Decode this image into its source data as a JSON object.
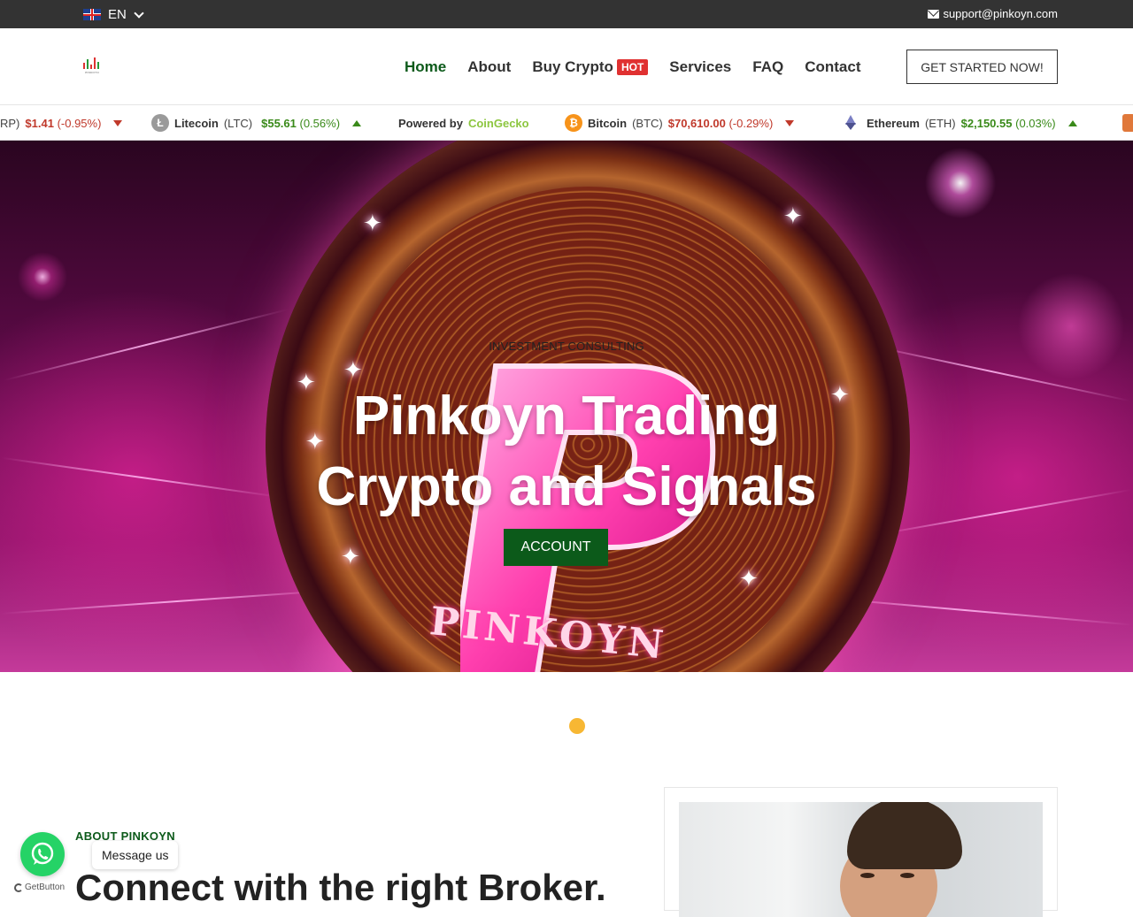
{
  "topbar": {
    "language": "EN",
    "support_email": "support@pinkoyn.com"
  },
  "header": {
    "logo_text": "PINKOYN",
    "nav": [
      {
        "label": "Home",
        "active": true
      },
      {
        "label": "About"
      },
      {
        "label": "Buy Crypto",
        "badge": "HOT"
      },
      {
        "label": "Services"
      },
      {
        "label": "FAQ"
      },
      {
        "label": "Contact"
      }
    ],
    "cta_label": "GET STARTED NOW!"
  },
  "ticker": {
    "xrp_partial": {
      "symbol_tail": "RP)",
      "price": "$1.41",
      "change": "(-0.95%)",
      "direction": "down"
    },
    "litecoin": {
      "name": "Litecoin",
      "symbol": "(LTC)",
      "price": "$55.61",
      "change": "(0.56%)",
      "direction": "up"
    },
    "powered_by": "Powered by",
    "powered_by_brand": "CoinGecko",
    "bitcoin": {
      "name": "Bitcoin",
      "symbol": "(BTC)",
      "price": "$70,610.00",
      "change": "(-0.29%)",
      "direction": "down"
    },
    "ethereum": {
      "name": "Ethereum",
      "symbol": "(ETH)",
      "price": "$2,150.55",
      "change": "(0.03%)",
      "direction": "up"
    }
  },
  "hero": {
    "subtitle": "INVESTMENT CONSULTING",
    "title_line1": "Pinkoyn Trading",
    "title_line2": "Crypto and Signals",
    "button": "ACCOUNT",
    "coin_text": "PINKOYN"
  },
  "about": {
    "label": "ABOUT PINKOYN",
    "title": "Connect with the right Broker."
  },
  "whatsapp": {
    "message": "Message us",
    "powered": "GetButton"
  },
  "colors": {
    "accent_green": "#0c5a1a",
    "hot_badge": "#e03131",
    "topbar": "#333333",
    "dot": "#f7b733",
    "whatsapp": "#25d366"
  }
}
